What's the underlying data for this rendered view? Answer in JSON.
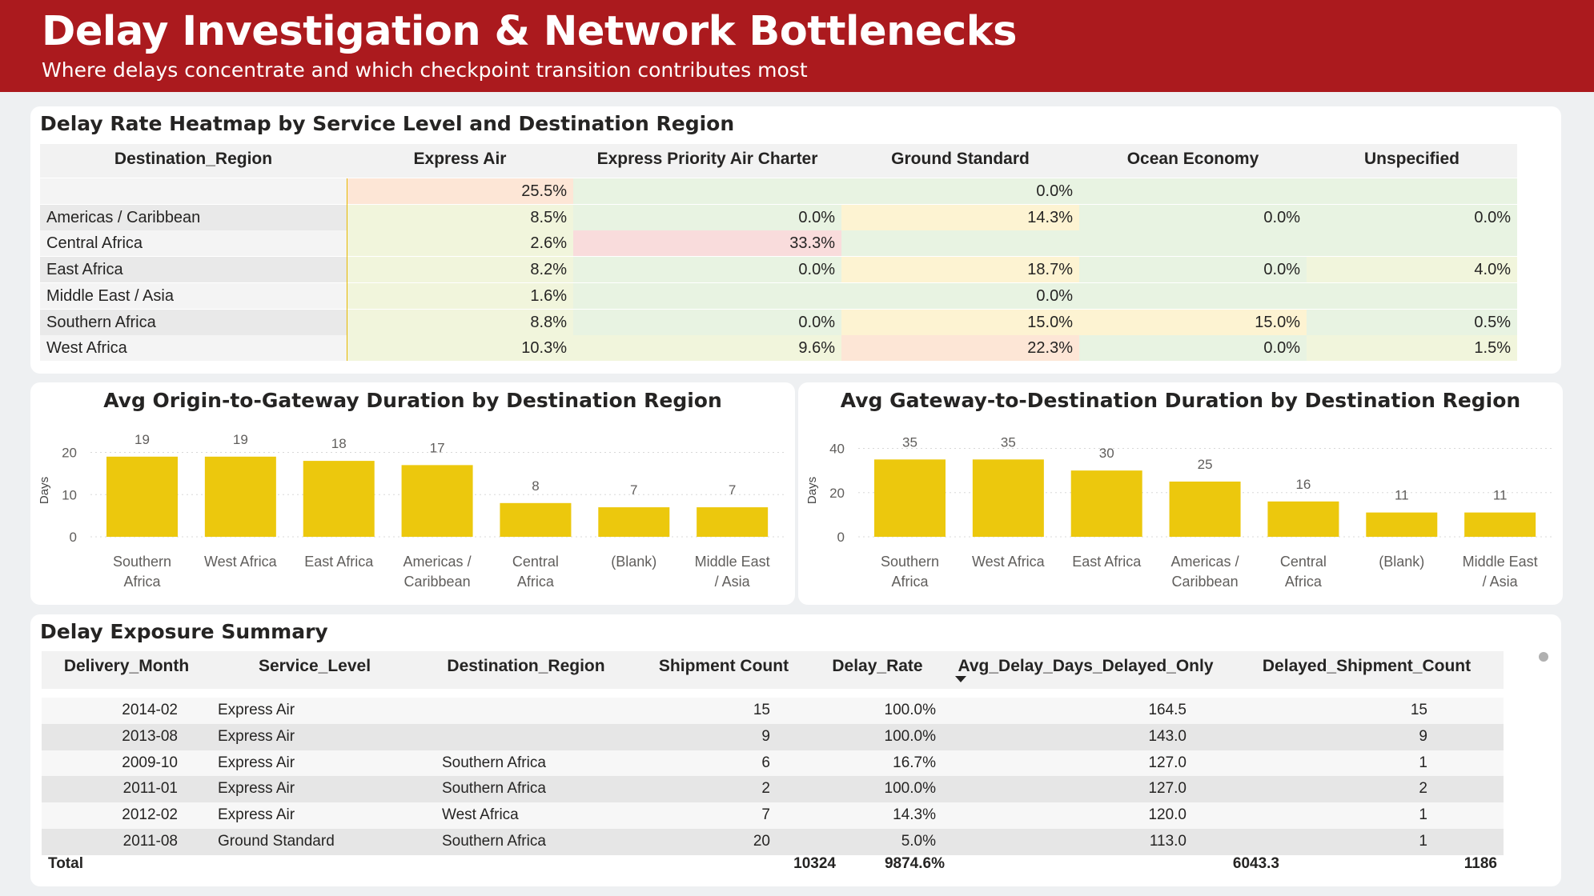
{
  "header": {
    "title": "Delay Investigation & Network Bottlenecks",
    "subtitle": "Where delays concentrate and which checkpoint transition contributes most"
  },
  "heatmap": {
    "title": "Delay Rate Heatmap by Service Level and Destination Region",
    "columns": [
      "Destination_Region",
      "Express Air",
      "Express Priority Air Charter",
      "Ground Standard",
      "Ocean Economy",
      "Unspecified"
    ],
    "rows": [
      {
        "label": "",
        "cells": [
          "25.5%",
          "",
          "0.0%",
          "",
          ""
        ]
      },
      {
        "label": "Americas / Caribbean",
        "cells": [
          "8.5%",
          "0.0%",
          "14.3%",
          "0.0%",
          "0.0%"
        ]
      },
      {
        "label": "Central Africa",
        "cells": [
          "2.6%",
          "33.3%",
          "",
          "",
          ""
        ]
      },
      {
        "label": "East Africa",
        "cells": [
          "8.2%",
          "0.0%",
          "18.7%",
          "0.0%",
          "4.0%"
        ]
      },
      {
        "label": "Middle East / Asia",
        "cells": [
          "1.6%",
          "",
          "0.0%",
          "",
          ""
        ]
      },
      {
        "label": "Southern Africa",
        "cells": [
          "8.8%",
          "0.0%",
          "15.0%",
          "15.0%",
          "0.5%"
        ]
      },
      {
        "label": "West Africa",
        "cells": [
          "10.3%",
          "9.6%",
          "22.3%",
          "0.0%",
          "1.5%"
        ]
      }
    ],
    "colors": {
      "low": "#e8f3e2",
      "mid_low": "#f1f5dc",
      "mid": "#fdf3d2",
      "high": "#fde6d6",
      "very_high": "#f9dcdc",
      "row_label_bg": "#e9e9e9"
    }
  },
  "chart_data": [
    {
      "type": "bar",
      "title": "Avg Origin-to-Gateway Duration by Destination Region",
      "ylabel": "Days",
      "categories": [
        "Southern Africa",
        "West Africa",
        "East Africa",
        "Americas / Caribbean",
        "Central Africa",
        "(Blank)",
        "Middle East / Asia"
      ],
      "category_lines": [
        [
          "Southern",
          "Africa"
        ],
        [
          "West Africa"
        ],
        [
          "East Africa"
        ],
        [
          "Americas /",
          "Caribbean"
        ],
        [
          "Central",
          "Africa"
        ],
        [
          "(Blank)"
        ],
        [
          "Middle East",
          "/ Asia"
        ]
      ],
      "values": [
        19,
        19,
        18,
        17,
        8,
        7,
        7
      ],
      "yticks": [
        0,
        10,
        20
      ],
      "ylim": [
        0,
        22
      ],
      "color": "#ecc80d",
      "grid": true
    },
    {
      "type": "bar",
      "title": "Avg Gateway-to-Destination Duration by Destination Region",
      "ylabel": "Days",
      "categories": [
        "Southern Africa",
        "West Africa",
        "East Africa",
        "Americas / Caribbean",
        "Central Africa",
        "(Blank)",
        "Middle East / Asia"
      ],
      "category_lines": [
        [
          "Southern",
          "Africa"
        ],
        [
          "West Africa"
        ],
        [
          "East Africa"
        ],
        [
          "Americas /",
          "Caribbean"
        ],
        [
          "Central",
          "Africa"
        ],
        [
          "(Blank)"
        ],
        [
          "Middle East",
          "/ Asia"
        ]
      ],
      "values": [
        35,
        35,
        30,
        25,
        16,
        11,
        11
      ],
      "yticks": [
        0,
        20,
        40
      ],
      "ylim": [
        0,
        42
      ],
      "color": "#ecc80d",
      "grid": true
    }
  ],
  "summary": {
    "title": "Delay Exposure Summary",
    "columns": [
      "Delivery_Month",
      "Service_Level",
      "Destination_Region",
      "Shipment Count",
      "Delay_Rate",
      "Avg_Delay_Days_Delayed_Only",
      "Delayed_Shipment_Count"
    ],
    "rows": [
      [
        "2014-02",
        "Express Air",
        "",
        "15",
        "100.0%",
        "164.5",
        "15"
      ],
      [
        "2013-08",
        "Express Air",
        "",
        "9",
        "100.0%",
        "143.0",
        "9"
      ],
      [
        "2009-10",
        "Express Air",
        "Southern Africa",
        "6",
        "16.7%",
        "127.0",
        "1"
      ],
      [
        "2011-01",
        "Express Air",
        "Southern Africa",
        "2",
        "100.0%",
        "127.0",
        "2"
      ],
      [
        "2012-02",
        "Express Air",
        "West Africa",
        "7",
        "14.3%",
        "120.0",
        "1"
      ],
      [
        "2011-08",
        "Ground Standard",
        "Southern Africa",
        "20",
        "5.0%",
        "113.0",
        "1"
      ]
    ],
    "total": {
      "label": "Total",
      "shipment_count": "10324",
      "delay_rate": "9874.6%",
      "avg_delay": "6043.3",
      "delayed_count": "1186"
    }
  }
}
